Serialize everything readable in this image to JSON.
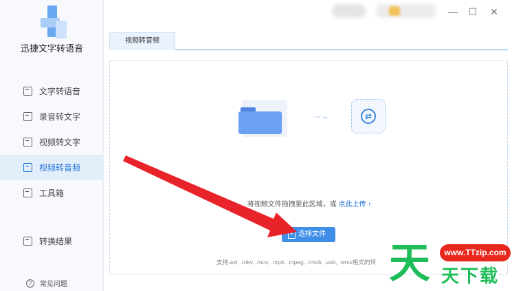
{
  "app": {
    "name": "迅捷文字转语音"
  },
  "sidebar": {
    "items": [
      {
        "label": "文字转语音",
        "icon": "text-to-speech-icon"
      },
      {
        "label": "录音转文字",
        "icon": "record-to-text-icon"
      },
      {
        "label": "视频转文字",
        "icon": "video-to-text-icon"
      },
      {
        "label": "视频转音频",
        "icon": "video-to-audio-icon",
        "active": true
      },
      {
        "label": "工具箱",
        "icon": "toolbox-icon"
      }
    ],
    "result": {
      "label": "转换结果",
      "icon": "result-icon"
    },
    "faq": {
      "label": "常见问题",
      "icon": "question-icon"
    }
  },
  "window": {
    "minimize": "—",
    "maximize": "☐",
    "close": "✕"
  },
  "tabs": [
    {
      "label": "视频转音频",
      "active": true
    }
  ],
  "main": {
    "hint_text": "将视频文件拖拽至此区域，或",
    "hint_link": "点此上传",
    "upload_arrow": "↑",
    "choose_button": "选择文件",
    "flow_arrow": "···→",
    "formats": "支持.avi, .mkv, .mov, .mp4, .mpeg, .rmvb, .vob, .wmv格式的转"
  },
  "watermark": {
    "big": "天",
    "site": "www.TTzip.com",
    "sub": "天下载"
  },
  "colors": {
    "accent": "#3f8ee8",
    "active_bg": "#e3eefb",
    "annotation": "#e8232a",
    "watermark_green": "#1dbd57"
  }
}
